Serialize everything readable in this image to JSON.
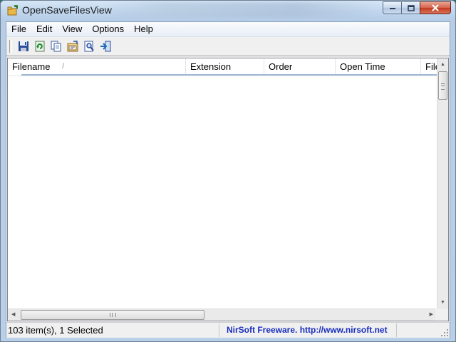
{
  "window": {
    "title": "OpenSaveFilesView",
    "icon": "app-folder-icon"
  },
  "caption": {
    "minimize_icon": "minimize-icon",
    "maximize_icon": "maximize-icon",
    "close_icon": "close-icon"
  },
  "menu": {
    "items": [
      {
        "label": "File"
      },
      {
        "label": "Edit"
      },
      {
        "label": "View"
      },
      {
        "label": "Options"
      },
      {
        "label": "Help"
      }
    ]
  },
  "toolbar": {
    "buttons": [
      {
        "icon": "save-icon"
      },
      {
        "icon": "refresh-icon"
      },
      {
        "icon": "copy-icon"
      },
      {
        "icon": "properties-icon"
      },
      {
        "icon": "find-icon"
      },
      {
        "icon": "exit-icon"
      }
    ]
  },
  "list": {
    "columns": [
      {
        "label": "Filename"
      },
      {
        "label": "Extension"
      },
      {
        "label": "Order"
      },
      {
        "label": "Open Time"
      },
      {
        "label": "File"
      }
    ],
    "sort_indicator": "/",
    "rows": []
  },
  "status": {
    "count": "103 item(s), 1 Selected",
    "link": "NirSoft Freeware.  http://www.nirsoft.net"
  },
  "colors": {
    "link": "#1a2ebd",
    "close_button": "#c23a1e"
  }
}
